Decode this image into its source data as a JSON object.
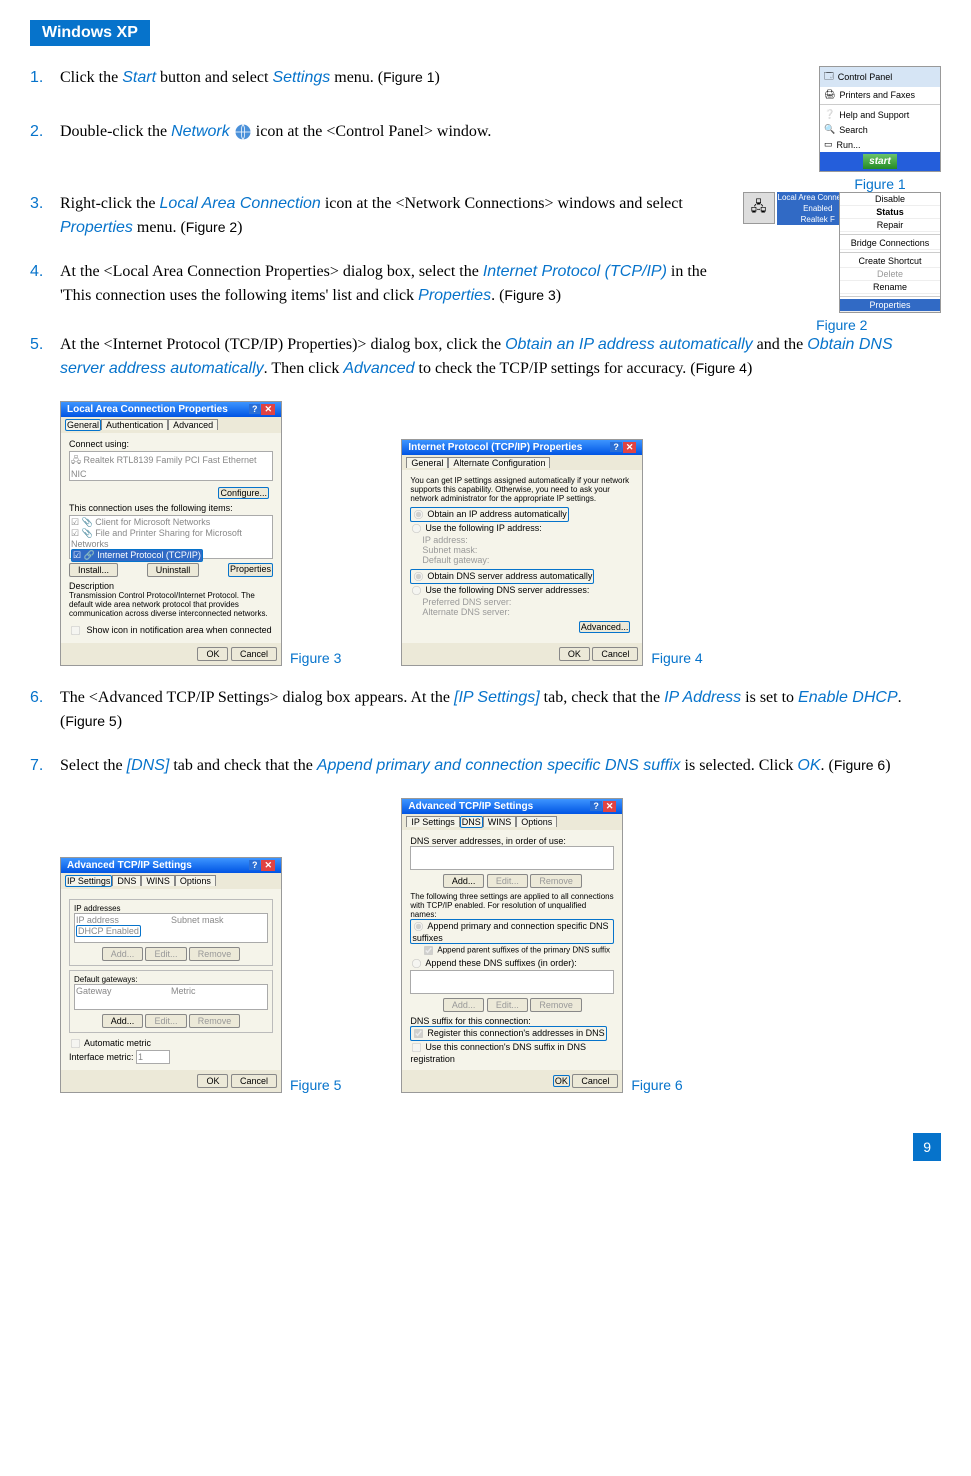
{
  "header": "Windows XP",
  "steps": [
    {
      "n": "1.",
      "pre": "Click the ",
      "i1": "Start",
      "mid": " button and select ",
      "i2": "Settings",
      "post": " menu. (",
      "fig": "Figure 1",
      "end": ")"
    },
    {
      "n": "2.",
      "pre": "Double-click the ",
      "i1": "Network",
      "post2": " icon at the <Control Panel> window."
    },
    {
      "n": "3.",
      "pre": "Right-click the ",
      "i1": "Local Area Connection",
      "mid": " icon at the <Network Connections> windows and select ",
      "i2": "Properties",
      "post": " menu. (",
      "fig": "Figure 2",
      "end": ")"
    },
    {
      "n": "4.",
      "pre": "At the <Local Area Connection Properties> dialog box, select the ",
      "i1": "Internet Protocol (TCP/IP)",
      "mid2": " in the 'This connection uses the following items' list and click ",
      "i2": "Properties",
      "post": ". (",
      "fig": "Figure 3",
      "end": ")"
    },
    {
      "n": "5.",
      "pre": "At the <Internet Protocol (TCP/IP) Properties)> dialog box, click the ",
      "i1": "Obtain an IP address automatically",
      "mid3": " and the ",
      "i2": "Obtain DNS server address automatically",
      "mid4": ". Then click ",
      "i3": "Advanced",
      "post3": " to check the TCP/IP settings for accuracy. (",
      "fig": "Figure 4",
      "end": ")"
    },
    {
      "n": "6.",
      "pre": "The <Advanced TCP/IP Settings> dialog box appears. At the ",
      "i1": "[IP Settings]",
      "mid5": " tab, check that the ",
      "i2": "IP Address",
      "mid6": " is set to ",
      "i3": "Enable DHCP",
      "post": ". (",
      "fig": "Figure 5",
      "end": ")"
    },
    {
      "n": "7.",
      "pre": "Select the ",
      "i1": "[DNS]",
      "mid7": " tab and check that the ",
      "i2": "Append primary and connection specific DNS suffix",
      "mid8": " is selected. Click ",
      "i3": "OK",
      "post": ". (",
      "fig": "Figure 6",
      "end": ")"
    }
  ],
  "fig1": {
    "items": [
      "Control Panel",
      "Printers and Faxes",
      "Help and Support",
      "Search",
      "Run..."
    ],
    "start": "start",
    "label": "Figure 1"
  },
  "fig2": {
    "lac_title": "Local Area Connection",
    "lac_sub1": "Enabled",
    "lac_sub2": "Realtek F",
    "menu": [
      "Disable",
      "Status",
      "Repair",
      "Bridge Connections",
      "Create Shortcut",
      "Delete",
      "Rename",
      "Properties"
    ],
    "label": "Figure 2"
  },
  "fig3": {
    "title": "Local Area Connection Properties",
    "tabs": [
      "General",
      "Authentication",
      "Advanced"
    ],
    "connect_using": "Connect using:",
    "adapter": "Realtek RTL8139 Family PCI Fast Ethernet NIC",
    "configure": "Configure...",
    "items_label": "This connection uses the following items:",
    "item1": "Client for Microsoft Networks",
    "item2": "File and Printer Sharing for Microsoft Networks",
    "item3": "Internet Protocol (TCP/IP)",
    "install": "Install...",
    "uninstall": "Uninstall",
    "properties": "Properties",
    "desc_label": "Description",
    "desc_text": "Transmission Control Protocol/Internet Protocol. The default wide area network protocol that provides communication across diverse interconnected networks.",
    "show_icon": "Show icon in notification area when connected",
    "ok": "OK",
    "cancel": "Cancel",
    "label": "Figure 3"
  },
  "fig4": {
    "title": "Internet Protocol (TCP/IP) Properties",
    "tabs": [
      "General",
      "Alternate Configuration"
    ],
    "desc": "You can get IP settings assigned automatically if your network supports this capability. Otherwise, you need to ask your network administrator for the appropriate IP settings.",
    "obtain_ip": "Obtain an IP address automatically",
    "use_ip": "Use the following IP address:",
    "ip_address": "IP address:",
    "subnet": "Subnet mask:",
    "gateway": "Default gateway:",
    "obtain_dns": "Obtain DNS server address automatically",
    "use_dns": "Use the following DNS server addresses:",
    "pref_dns": "Preferred DNS server:",
    "alt_dns": "Alternate DNS server:",
    "advanced": "Advanced...",
    "ok": "OK",
    "cancel": "Cancel",
    "label": "Figure 4"
  },
  "fig5": {
    "title": "Advanced TCP/IP Settings",
    "tabs": [
      "IP Settings",
      "DNS",
      "WINS",
      "Options"
    ],
    "ip_addresses": "IP addresses",
    "ip_address": "IP address",
    "subnet": "Subnet mask",
    "dhcp": "DHCP Enabled",
    "add": "Add...",
    "edit": "Edit...",
    "remove": "Remove",
    "def_gw": "Default gateways:",
    "gateway": "Gateway",
    "metric": "Metric",
    "auto_metric": "Automatic metric",
    "if_metric": "Interface metric:",
    "if_val": "1",
    "ok": "OK",
    "cancel": "Cancel",
    "label": "Figure 5"
  },
  "fig6": {
    "title": "Advanced TCP/IP Settings",
    "tabs": [
      "IP Settings",
      "DNS",
      "WINS",
      "Options"
    ],
    "dns_addr": "DNS server addresses, in order of use:",
    "add": "Add...",
    "edit": "Edit...",
    "remove": "Remove",
    "note": "The following three settings are applied to all connections with TCP/IP enabled. For resolution of unqualified names:",
    "append_primary": "Append primary and connection specific DNS suffixes",
    "append_parent": "Append parent suffixes of the primary DNS suffix",
    "append_these": "Append these DNS suffixes (in order):",
    "dns_suffix": "DNS suffix for this connection:",
    "register": "Register this connection's addresses in DNS",
    "use_suffix": "Use this connection's DNS suffix in DNS registration",
    "ok": "OK",
    "cancel": "Cancel",
    "label": "Figure 6"
  },
  "page_number": "9"
}
